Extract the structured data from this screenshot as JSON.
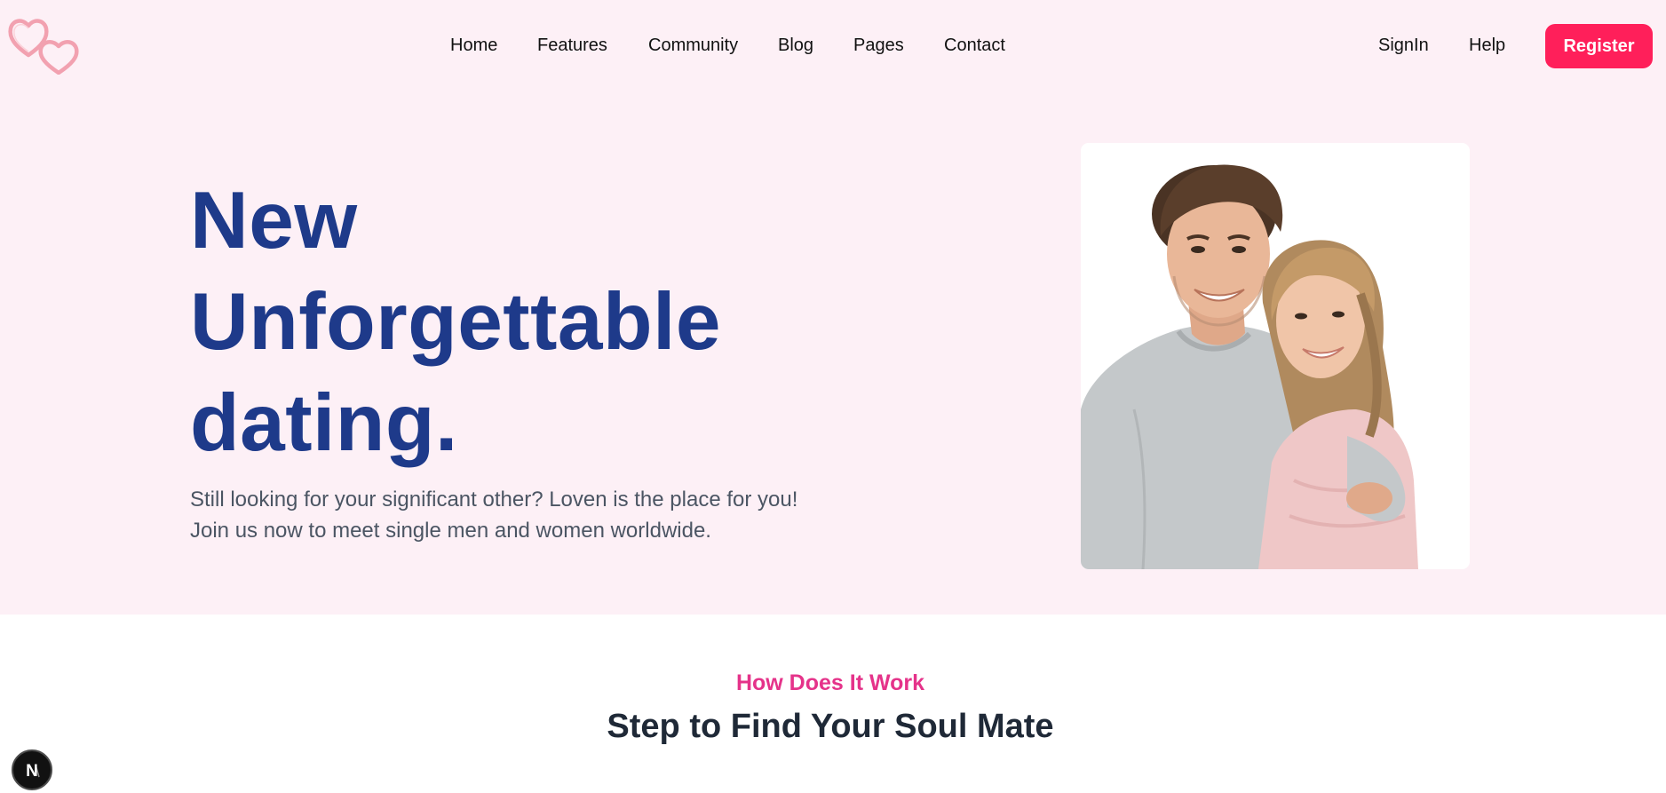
{
  "header": {
    "logo_icon": "double-heart-icon",
    "nav": [
      {
        "label": "Home"
      },
      {
        "label": "Features"
      },
      {
        "label": "Community"
      },
      {
        "label": "Blog"
      },
      {
        "label": "Pages"
      },
      {
        "label": "Contact"
      }
    ],
    "signin_label": "SignIn",
    "help_label": "Help",
    "register_label": "Register"
  },
  "hero": {
    "title_lines": [
      "New",
      "Unforgettable",
      "dating."
    ],
    "subtitle_lines": [
      "Still looking for your significant other? Loven is the place for you!",
      "Join us now to meet single men and women worldwide."
    ],
    "image": "smiling-couple-photo"
  },
  "how_it_works": {
    "eyebrow": "How Does It Work",
    "title": "Step to Find Your Soul Mate"
  },
  "dev_badge": {
    "icon": "nextjs-n-icon",
    "letter": "N"
  },
  "colors": {
    "page_background": "#fdf0f6",
    "brand_pink": "#ff1f5a",
    "heading_blue": "#1e3a8a",
    "eyebrow_pink": "#e5338a",
    "section_title": "#1f2937"
  }
}
